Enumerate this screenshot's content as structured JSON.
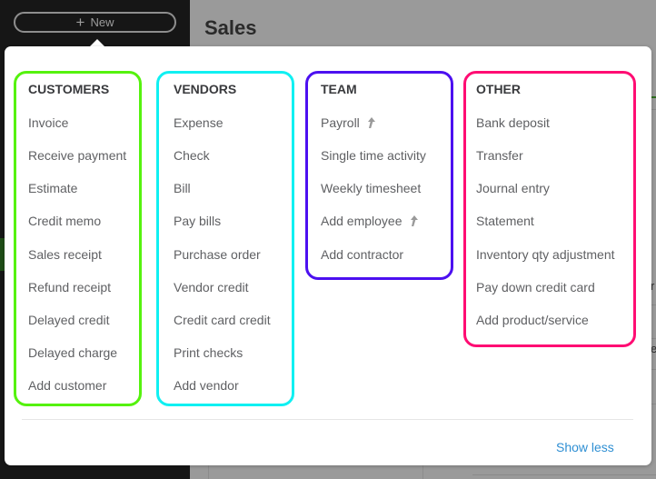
{
  "app": {
    "new_button_label": "New",
    "page_title": "Sales"
  },
  "menu": {
    "columns": [
      {
        "heading": "CUSTOMERS",
        "color": "#55f20e",
        "items": [
          {
            "label": "Invoice"
          },
          {
            "label": "Receive payment"
          },
          {
            "label": "Estimate"
          },
          {
            "label": "Credit memo"
          },
          {
            "label": "Sales receipt"
          },
          {
            "label": "Refund receipt"
          },
          {
            "label": "Delayed credit"
          },
          {
            "label": "Delayed charge"
          },
          {
            "label": "Add customer"
          }
        ]
      },
      {
        "heading": "VENDORS",
        "color": "#10f0f2",
        "items": [
          {
            "label": "Expense"
          },
          {
            "label": "Check"
          },
          {
            "label": "Bill"
          },
          {
            "label": "Pay bills"
          },
          {
            "label": "Purchase order"
          },
          {
            "label": "Vendor credit"
          },
          {
            "label": "Credit card credit"
          },
          {
            "label": "Print checks"
          },
          {
            "label": "Add vendor"
          }
        ]
      },
      {
        "heading": "TEAM",
        "color": "#4c10f0",
        "items": [
          {
            "label": "Payroll",
            "icon": "upgrade-arrow-icon"
          },
          {
            "label": "Single time activity"
          },
          {
            "label": "Weekly timesheet"
          },
          {
            "label": "Add employee",
            "icon": "upgrade-arrow-icon"
          },
          {
            "label": "Add contractor"
          }
        ]
      },
      {
        "heading": "OTHER",
        "color": "#ff0d73",
        "items": [
          {
            "label": "Bank deposit"
          },
          {
            "label": "Transfer"
          },
          {
            "label": "Journal entry"
          },
          {
            "label": "Statement"
          },
          {
            "label": "Inventory qty adjustment"
          },
          {
            "label": "Pay down credit card"
          },
          {
            "label": "Add product/service"
          }
        ]
      }
    ],
    "show_less_label": "Show less",
    "link_color": "#2f8fd3"
  },
  "background": {
    "fragments": [
      "r",
      "e"
    ]
  }
}
